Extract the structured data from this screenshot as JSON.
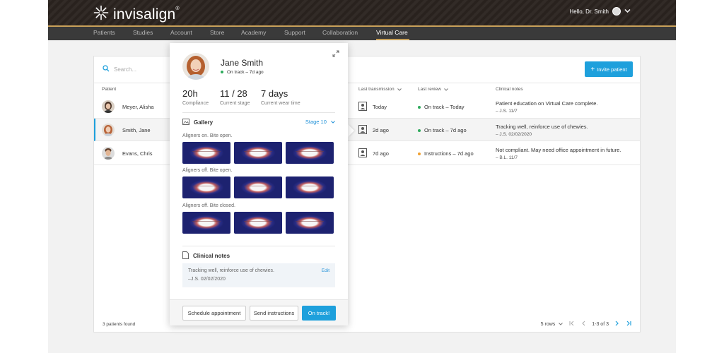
{
  "header": {
    "logo_text": "invisalign",
    "logo_mark": "®",
    "greeting": "Hello, Dr. Smith"
  },
  "nav": {
    "items": [
      {
        "label": "Patients"
      },
      {
        "label": "Studies"
      },
      {
        "label": "Account"
      },
      {
        "label": "Store"
      },
      {
        "label": "Academy"
      },
      {
        "label": "Support"
      },
      {
        "label": "Collaboration"
      },
      {
        "label": "Virtual Care"
      }
    ],
    "active": "Virtual Care"
  },
  "toolbar": {
    "search_placeholder": "Search...",
    "invite_label": "Invite patient",
    "invite_plus": "+"
  },
  "table": {
    "columns": [
      "Patient",
      "Last transmission",
      "Last review",
      "Clinical notes"
    ],
    "rows": [
      {
        "name": "Meyer, Alisha",
        "transmission": "Today",
        "review": "On track – Today",
        "review_color": "#2eaa5c",
        "note": "Patient education on Virtual Care complete.",
        "note_by": "– J.S. 11/7"
      },
      {
        "name": "Smith, Jane",
        "transmission": "2d ago",
        "review": "On track – 7d ago",
        "review_color": "#2eaa5c",
        "note": "Tracking well, reinforce use of chewies.",
        "note_by": "– J.S. 02/02/2020"
      },
      {
        "name": "Evans, Chris",
        "transmission": "7d ago",
        "review": "Instructions – 7d ago",
        "review_color": "#f0a030",
        "note": "Not compliant. May need office appointment in future.",
        "note_by": "– B.L. 11/7"
      }
    ]
  },
  "footer": {
    "count": "3 patients found",
    "rows_label": "5 rows",
    "page": "1-3 of 3"
  },
  "popup": {
    "name": "Jane Smith",
    "status": "On track – 7d ago",
    "status_color": "#2eaa5c",
    "stats": [
      {
        "value": "20h",
        "label": "Compliance"
      },
      {
        "value": "11 / 28",
        "label": "Current stage"
      },
      {
        "value": "7 days",
        "label": "Current wear time"
      }
    ],
    "gallery_title": "Gallery",
    "stage_label": "Stage 10",
    "gallery_groups": [
      {
        "label": "Aligners on. Bite open."
      },
      {
        "label": "Aligners off. Bite open."
      },
      {
        "label": "Aligners off. Bite closed."
      }
    ],
    "notes_title": "Clinical notes",
    "note_text": "Tracking well, reinforce use of chewies.",
    "note_sig": "–J.S. 02/02/2020",
    "edit_label": "Edit",
    "buttons": {
      "schedule": "Schedule appointment",
      "send": "Send instructions",
      "ontrack": "On track!"
    }
  },
  "colors": {
    "accent": "#1ea0dc",
    "header_bg": "#2b2420",
    "nav_bg": "#3a3a3a",
    "gold": "#c9a15a"
  }
}
